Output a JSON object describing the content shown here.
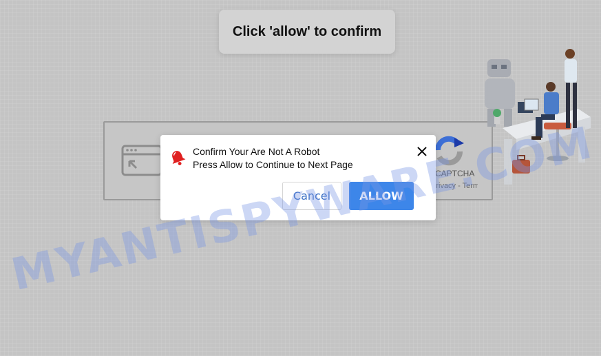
{
  "toast": {
    "text": "Click 'allow' to confirm"
  },
  "captcha": {
    "brand": "CAPTCHA",
    "links": "Privacy - Terms"
  },
  "dialog": {
    "line1": "Confirm Your Are Not A Robot",
    "line2": "Press Allow to Continue to Next Page",
    "cancel_label": "Cancel",
    "allow_label": "ALLOW"
  },
  "watermark": {
    "text": "MYANTISPYWARE.COM"
  },
  "icons": {
    "bell": "bell-icon",
    "close": "close-icon",
    "browser": "browser-window-icon",
    "recaptcha": "recaptcha-logo-icon"
  },
  "colors": {
    "background": "#c4c4c4",
    "allow_button": "#3d86e9",
    "cancel_text": "#3a6fc4",
    "bell": "#e02020"
  }
}
